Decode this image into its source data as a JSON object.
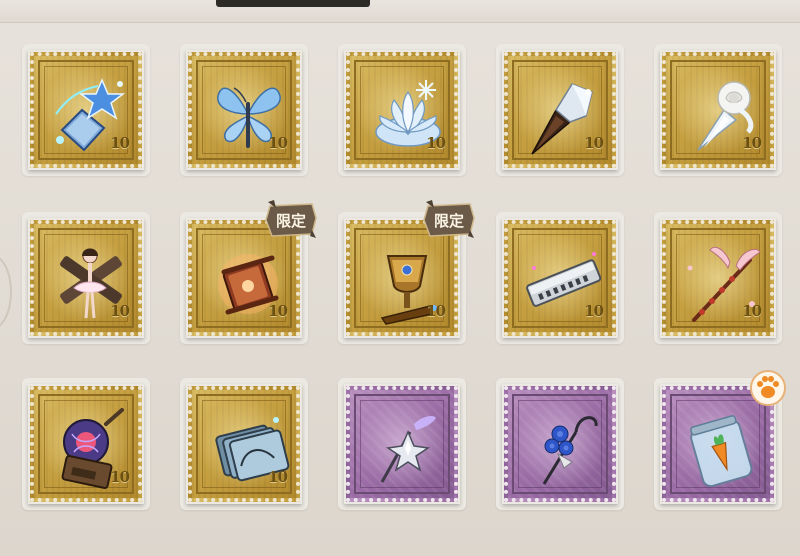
{
  "collection": {
    "stamp_value_text": "10",
    "rows": [
      [
        {
          "icon": "crystal-lantern-icon",
          "frame": "gold",
          "tag": ""
        },
        {
          "icon": "blue-butterfly-icon",
          "frame": "gold",
          "tag": ""
        },
        {
          "icon": "ice-lotus-icon",
          "frame": "gold",
          "tag": ""
        },
        {
          "icon": "crystal-torch-icon",
          "frame": "gold",
          "tag": ""
        },
        {
          "icon": "white-rose-bouquet-icon",
          "frame": "gold",
          "tag": ""
        }
      ],
      [
        {
          "icon": "ballerina-cross-icon",
          "frame": "gold",
          "tag": ""
        },
        {
          "icon": "ornate-scroll-icon",
          "frame": "gold",
          "tag": "限定"
        },
        {
          "icon": "golden-goblet-icon",
          "frame": "gold",
          "tag": "限定"
        },
        {
          "icon": "harmonica-icon",
          "frame": "gold",
          "tag": ""
        },
        {
          "icon": "pink-wing-cane-icon",
          "frame": "gold",
          "tag": ""
        }
      ],
      [
        {
          "icon": "plasma-lantern-icon",
          "frame": "gold",
          "tag": ""
        },
        {
          "icon": "crystal-cards-icon",
          "frame": "gold",
          "tag": ""
        },
        {
          "icon": "star-pendulum-icon",
          "frame": "purple",
          "tag": ""
        },
        {
          "icon": "blue-rose-cane-icon",
          "frame": "purple",
          "tag": ""
        },
        {
          "icon": "carrot-jar-icon",
          "frame": "purple",
          "tag": "paw"
        }
      ]
    ]
  },
  "colors": {
    "gold_frame": "#c6a041",
    "purple_frame": "#9b6da6",
    "limited_badge": "#6b5a48",
    "paw_badge": "#f08a24"
  }
}
